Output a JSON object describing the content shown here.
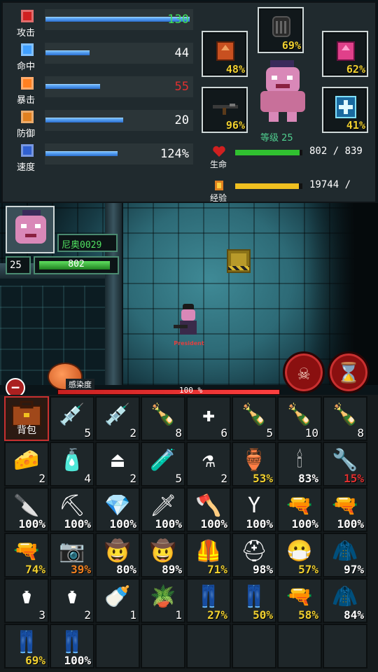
{
  "stats": [
    {
      "label": "攻击",
      "value": "130",
      "value_color": "#40e060",
      "fill": 0.98,
      "icon": "sword-icon",
      "icon_color": "#d02020"
    },
    {
      "label": "命中",
      "value": "44",
      "value_color": "#ffffff",
      "fill": 0.3,
      "icon": "crosshair-icon",
      "icon_color": "#40a0ff"
    },
    {
      "label": "暴击",
      "value": "55",
      "value_color": "#e03030",
      "fill": 0.37,
      "icon": "explosion-icon",
      "icon_color": "#ff8020"
    },
    {
      "label": "防御",
      "value": "20",
      "value_color": "#ffffff",
      "fill": 0.53,
      "icon": "shield-icon",
      "icon_color": "#e08020"
    },
    {
      "label": "速度",
      "value": "124%",
      "value_color": "#ffffff",
      "fill": 0.49,
      "icon": "boot-icon",
      "icon_color": "#3060d0"
    }
  ],
  "equipment": [
    {
      "name": "helmet-slot",
      "pct": "69%",
      "icon": "helmet-icon"
    },
    {
      "name": "armor-slot",
      "pct": "48%",
      "icon": "armor-icon"
    },
    {
      "name": "pants-slot",
      "pct": "62%",
      "icon": "pants-icon"
    },
    {
      "name": "weapon-slot",
      "pct": "96%",
      "icon": "rifle-icon"
    },
    {
      "name": "accessory-slot",
      "pct": "41%",
      "icon": "medkit-crystal-icon"
    }
  ],
  "level_label": "等级 25",
  "vitals": {
    "hp_label": "生命",
    "hp_text": "802 / 839",
    "hp_fill": 0.956,
    "hp_color": "#30c030",
    "xp_label": "经验",
    "xp_text": "19744 /",
    "xp_fill": 0.95,
    "xp_color": "#f0c020"
  },
  "hud": {
    "name": "尼奥0029",
    "level": "25",
    "hp": "802",
    "hp_fill": 0.956
  },
  "player_tag": "President",
  "infection": {
    "label": "感染度",
    "percent_text": "100 %",
    "fill": 1.0
  },
  "bag_label": "背包",
  "inventory": [
    {
      "icon": "syringe-icon",
      "glyph": "💉",
      "count": "5",
      "pct": false
    },
    {
      "icon": "syringe-icon",
      "glyph": "💉",
      "count": "2",
      "pct": false
    },
    {
      "icon": "green-bottle-icon",
      "glyph": "🍾",
      "count": "8",
      "pct": false
    },
    {
      "icon": "medkit-icon",
      "glyph": "✚",
      "count": "6",
      "pct": false
    },
    {
      "icon": "green-bottle-icon",
      "glyph": "🍾",
      "count": "5",
      "pct": false
    },
    {
      "icon": "purple-bottle-icon",
      "glyph": "🍾",
      "count": "10",
      "pct": false
    },
    {
      "icon": "green-bottle-icon",
      "glyph": "🍾",
      "count": "8",
      "pct": false
    },
    {
      "icon": "cheese-icon",
      "glyph": "🧀",
      "count": "2",
      "pct": false
    },
    {
      "icon": "sauce-bottle-icon",
      "glyph": "🧴",
      "count": "4",
      "pct": false
    },
    {
      "icon": "landmine-icon",
      "glyph": "⏏",
      "count": "2",
      "pct": false
    },
    {
      "icon": "vial-icon",
      "glyph": "🧪",
      "count": "5",
      "pct": false
    },
    {
      "icon": "flask-icon",
      "glyph": "⚗",
      "count": "2",
      "pct": false
    },
    {
      "icon": "water-jug-icon",
      "glyph": "🏺",
      "count": "53%",
      "pct": true,
      "color": "#f0d030"
    },
    {
      "icon": "glowstick-icon",
      "glyph": "🕯",
      "count": "83%",
      "pct": true,
      "color": "#ffffff"
    },
    {
      "icon": "wrench-icon",
      "glyph": "🔧",
      "count": "15%",
      "pct": true,
      "color": "#e03030"
    },
    {
      "icon": "pocket-knife-icon",
      "glyph": "🔪",
      "count": "100%",
      "pct": true,
      "color": "#ffffff"
    },
    {
      "icon": "shovel-icon",
      "glyph": "⛏",
      "count": "100%",
      "pct": true,
      "color": "#ffffff"
    },
    {
      "icon": "crystal-blade-icon",
      "glyph": "💎",
      "count": "100%",
      "pct": true,
      "color": "#ffffff"
    },
    {
      "icon": "machete-icon",
      "glyph": "🗡",
      "count": "100%",
      "pct": true,
      "color": "#ffffff"
    },
    {
      "icon": "axe-icon",
      "glyph": "🪓",
      "count": "100%",
      "pct": true,
      "color": "#ffffff"
    },
    {
      "icon": "slingshot-icon",
      "glyph": "Y",
      "count": "100%",
      "pct": true,
      "color": "#ffffff"
    },
    {
      "icon": "pistol-icon",
      "glyph": "🔫",
      "count": "100%",
      "pct": true,
      "color": "#ffffff"
    },
    {
      "icon": "shotgun-icon",
      "glyph": "🔫",
      "count": "100%",
      "pct": true,
      "color": "#ffffff"
    },
    {
      "icon": "freeze-gun-icon",
      "glyph": "🔫",
      "count": "74%",
      "pct": true,
      "color": "#f0d030"
    },
    {
      "icon": "camera-icon",
      "glyph": "📷",
      "count": "39%",
      "pct": true,
      "color": "#f08020"
    },
    {
      "icon": "cowboy-hat-icon",
      "glyph": "🤠",
      "count": "80%",
      "pct": true,
      "color": "#ffffff"
    },
    {
      "icon": "cowboy-hat-icon",
      "glyph": "🤠",
      "count": "89%",
      "pct": true,
      "color": "#ffffff"
    },
    {
      "icon": "vest-icon",
      "glyph": "🦺",
      "count": "71%",
      "pct": true,
      "color": "#f0d030"
    },
    {
      "icon": "nurse-cap-icon",
      "glyph": "⛑",
      "count": "98%",
      "pct": true,
      "color": "#ffffff"
    },
    {
      "icon": "gas-mask-icon",
      "glyph": "😷",
      "count": "57%",
      "pct": true,
      "color": "#f0d030"
    },
    {
      "icon": "jacket-icon",
      "glyph": "🧥",
      "count": "97%",
      "pct": true,
      "color": "#ffffff"
    },
    {
      "icon": "potion-icon",
      "glyph": "⚱",
      "count": "3",
      "pct": false
    },
    {
      "icon": "dark-potion-icon",
      "glyph": "⚱",
      "count": "2",
      "pct": false
    },
    {
      "icon": "milk-bottle-icon",
      "glyph": "🍼",
      "count": "1",
      "pct": false
    },
    {
      "icon": "plant-pot-icon",
      "glyph": "🪴",
      "count": "1",
      "pct": false
    },
    {
      "icon": "green-pants-icon",
      "glyph": "👖",
      "count": "27%",
      "pct": true,
      "color": "#f0d030"
    },
    {
      "icon": "green-pants-icon",
      "glyph": "👖",
      "count": "50%",
      "pct": true,
      "color": "#f0d030"
    },
    {
      "icon": "rifle-icon",
      "glyph": "🔫",
      "count": "58%",
      "pct": true,
      "color": "#f0d030"
    },
    {
      "icon": "jacket-icon",
      "glyph": "🧥",
      "count": "84%",
      "pct": true,
      "color": "#ffffff"
    },
    {
      "icon": "green-pants-icon",
      "glyph": "👖",
      "count": "69%",
      "pct": true,
      "color": "#f0d030"
    },
    {
      "icon": "green-pants-icon",
      "glyph": "👖",
      "count": "100%",
      "pct": true,
      "color": "#ffffff"
    }
  ]
}
